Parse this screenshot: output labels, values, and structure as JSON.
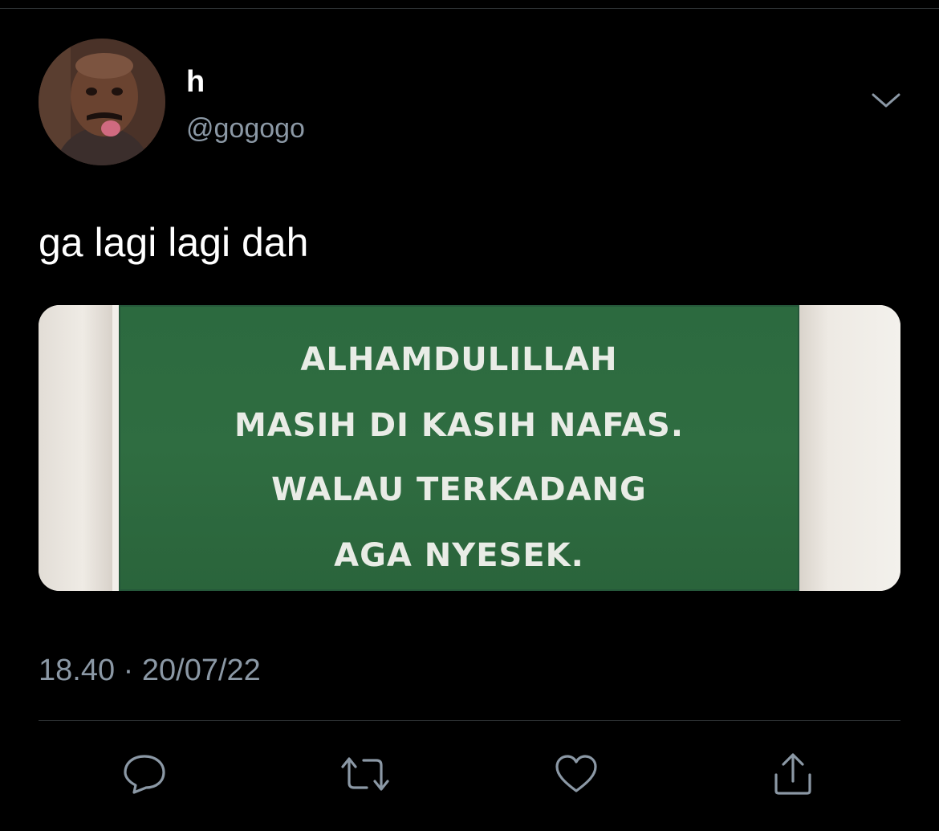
{
  "tweet": {
    "display_name": "h",
    "handle": "@gogogo",
    "text": "ga lagi lagi dah",
    "timestamp": "18.40 · 20/07/22"
  },
  "media": {
    "sign_lines": [
      "ALHAMDULILLAH",
      "MASIH DI KASIH NAFAS.",
      "WALAU TERKADANG",
      "AGA NYESEK."
    ],
    "sign_color": "#2f6d41"
  },
  "icons": {
    "caret": "chevron-down-icon",
    "reply": "reply-icon",
    "retweet": "retweet-icon",
    "like": "heart-icon",
    "share": "share-icon"
  },
  "colors": {
    "background": "#000000",
    "secondary_text": "#8b98a5",
    "divider": "#2f3336"
  }
}
